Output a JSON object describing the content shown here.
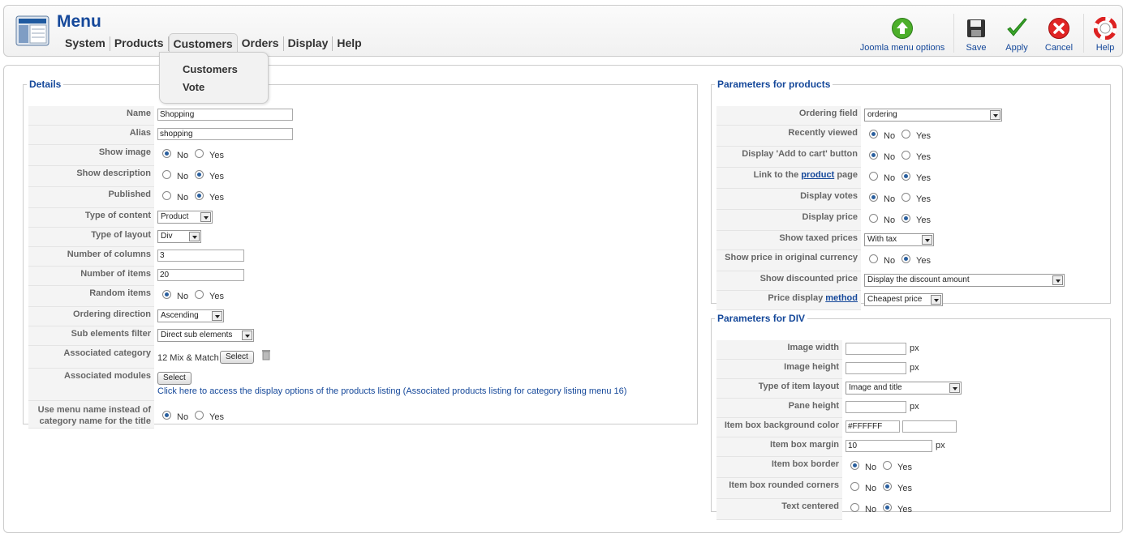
{
  "header": {
    "title": "Menu",
    "menu": [
      "System",
      "Products",
      "Customers",
      "Orders",
      "Display",
      "Help"
    ],
    "dropdown": [
      "Customers",
      "Vote"
    ],
    "toolbar": {
      "options": "Joomla menu options",
      "save": "Save",
      "apply": "Apply",
      "cancel": "Cancel",
      "help": "Help"
    }
  },
  "radio_labels": {
    "no": "No",
    "yes": "Yes"
  },
  "details": {
    "legend": "Details",
    "name": {
      "label": "Name",
      "value": "Shopping"
    },
    "alias": {
      "label": "Alias",
      "value": "shopping"
    },
    "show_image": {
      "label": "Show image",
      "value": "No"
    },
    "show_description": {
      "label": "Show description",
      "value": "Yes"
    },
    "published": {
      "label": "Published",
      "value": "Yes"
    },
    "type_of_content": {
      "label": "Type of content",
      "value": "Product"
    },
    "type_of_layout": {
      "label": "Type of layout",
      "value": "Div"
    },
    "number_of_columns": {
      "label": "Number of columns",
      "value": "3"
    },
    "number_of_items": {
      "label": "Number of items",
      "value": "20"
    },
    "random_items": {
      "label": "Random items",
      "value": "No"
    },
    "ordering_direction": {
      "label": "Ordering direction",
      "value": "Ascending"
    },
    "sub_elements_filter": {
      "label": "Sub elements filter",
      "value": "Direct sub elements"
    },
    "associated_category": {
      "label": "Associated category",
      "value": "12 Mix & Match",
      "button": "Select"
    },
    "associated_modules": {
      "label": "Associated modules",
      "button": "Select",
      "link": "Click here to access the display options of the products listing (Associated products listing for category listing menu 16)"
    },
    "use_menu_name": {
      "label_line1": "Use menu name instead of",
      "label_line2": "category name for the title",
      "value": "No"
    }
  },
  "products": {
    "legend": "Parameters for products",
    "ordering_field": {
      "label": "Ordering field",
      "value": "ordering"
    },
    "recently_viewed": {
      "label": "Recently viewed",
      "value": "No"
    },
    "add_to_cart": {
      "label": "Display 'Add to cart' button",
      "value": "No"
    },
    "link_to_product": {
      "label_pre": "Link to the",
      "label_link": "product",
      "label_post": "page",
      "value": "Yes"
    },
    "display_votes": {
      "label": "Display votes",
      "value": "No"
    },
    "display_price": {
      "label": "Display price",
      "value": "Yes"
    },
    "show_taxed_prices": {
      "label": "Show taxed prices",
      "value": "With tax"
    },
    "original_currency": {
      "label": "Show price in original currency",
      "value": "Yes"
    },
    "discounted_price": {
      "label": "Show discounted price",
      "value": "Display the discount amount"
    },
    "price_display_method": {
      "label_pre": "Price display",
      "label_link": "method",
      "value": "Cheapest price"
    }
  },
  "div": {
    "legend": "Parameters for DIV",
    "unit": "px",
    "image_width": {
      "label": "Image width",
      "value": ""
    },
    "image_height": {
      "label": "Image height",
      "value": ""
    },
    "item_layout": {
      "label": "Type of item layout",
      "value": "Image and title"
    },
    "pane_height": {
      "label": "Pane height",
      "value": ""
    },
    "bg_color": {
      "label": "Item box background color",
      "value": "#FFFFFF"
    },
    "box_margin": {
      "label": "Item box margin",
      "value": "10"
    },
    "box_border": {
      "label": "Item box border",
      "value": "No"
    },
    "rounded_corners": {
      "label": "Item box rounded corners",
      "value": "Yes"
    },
    "text_centered": {
      "label": "Text centered",
      "value": "Yes"
    }
  }
}
